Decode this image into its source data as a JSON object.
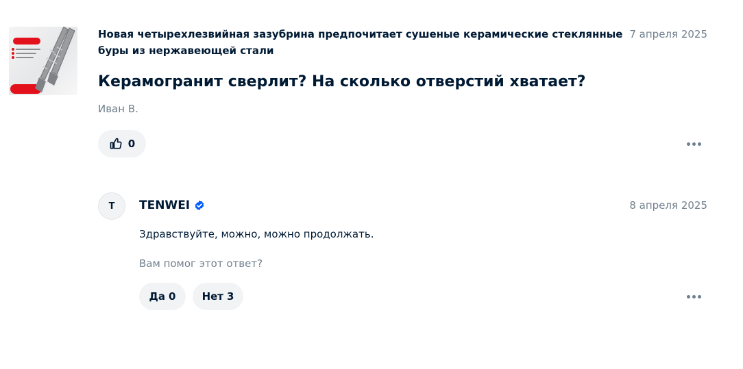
{
  "question": {
    "product_title": "Новая четырехлезвийная зазубрина предпочитает сушеные керамические стеклянные буры из нержавеющей стали",
    "date": "7 апреля 2025",
    "text": "Керамогранит сверлит? На сколько отверстий хватает?",
    "author": "Иван В.",
    "likes": "0"
  },
  "answer": {
    "avatar_letter": "T",
    "seller": "TENWEI",
    "date": "8 апреля 2025",
    "text": "Здравствуйте, можно, можно продолжать.",
    "helpful_question": "Вам помог этот ответ?",
    "yes_label": "Да",
    "yes_count": "0",
    "no_label": "Нет",
    "no_count": "3"
  },
  "icons": {
    "like": "thumbs-up-icon",
    "more": "more-dots-icon",
    "verified": "verified-check-icon"
  },
  "colors": {
    "text": "#001a34",
    "secondary": "#707f8d",
    "pill_bg": "#f2f3f5",
    "verified": "#005bff",
    "thumb_accent": "#e3111b"
  }
}
